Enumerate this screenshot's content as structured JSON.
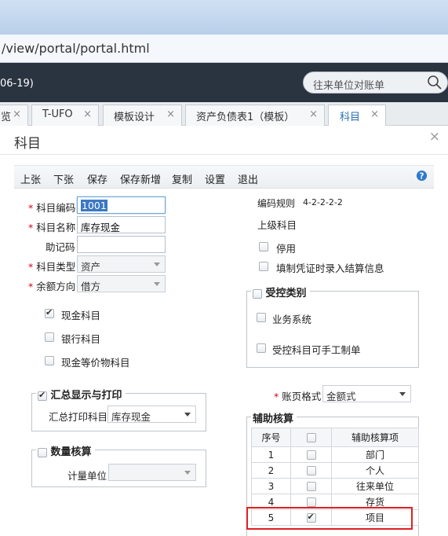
{
  "browser": {
    "address": "/view/portal/portal.html"
  },
  "portal": {
    "date_fragment": "06-19)",
    "search_placeholder": "往来单位对账单"
  },
  "tabs": [
    {
      "label": "览",
      "close": "×"
    },
    {
      "label": "T-UFO",
      "close": "×"
    },
    {
      "label": "模板设计",
      "close": "×"
    },
    {
      "label": "资产负债表1（模板）",
      "close": "×"
    },
    {
      "label": "科目",
      "close": "×",
      "active": true
    }
  ],
  "dialog": {
    "title": "科目",
    "close": "×",
    "toolbar": [
      "上张",
      "下张",
      "保存",
      "保存新增",
      "复制",
      "设置",
      "退出"
    ],
    "required_mark": "*",
    "fields": {
      "code_label": "科目编码",
      "code_value": "1001",
      "name_label": "科目名称",
      "name_value": "库存现金",
      "mnemonic_label": "助记码",
      "mnemonic_value": "",
      "type_label": "科目类型",
      "type_value": "资产",
      "balance_label": "余额方向",
      "balance_value": "借方"
    },
    "left_checks": [
      {
        "label": "现金科目",
        "checked": true
      },
      {
        "label": "银行科目",
        "checked": false
      },
      {
        "label": "现金等价物科目",
        "checked": false
      }
    ],
    "summary_group": {
      "legend": "汇总显示与打印",
      "checked": true,
      "label": "汇总打印科目",
      "value": "库存现金"
    },
    "quantity_group": {
      "legend": "数量核算",
      "checked": false,
      "label": "计量单位",
      "value": ""
    },
    "right": {
      "rule_label": "编码规则",
      "rule_value": "4-2-2-2-2",
      "parent_label": "上级科目",
      "disabled_label": "停用",
      "voucher_label": "填制凭证时录入结算信息",
      "controlled_legend": "受控类别",
      "business_label": "业务系统",
      "manual_label": "受控科目可手工制单",
      "page_format_label": "账页格式",
      "page_format_value": "金额式",
      "aux_legend": "辅助核算",
      "aux_headers": [
        "序号",
        "",
        "辅助核算项"
      ],
      "aux_rows": [
        {
          "no": "1",
          "checked": false,
          "name": "部门"
        },
        {
          "no": "2",
          "checked": false,
          "name": "个人"
        },
        {
          "no": "3",
          "checked": false,
          "name": "往来单位"
        },
        {
          "no": "4",
          "checked": false,
          "name": "存货"
        },
        {
          "no": "5",
          "checked": true,
          "name": "项目"
        }
      ]
    }
  }
}
